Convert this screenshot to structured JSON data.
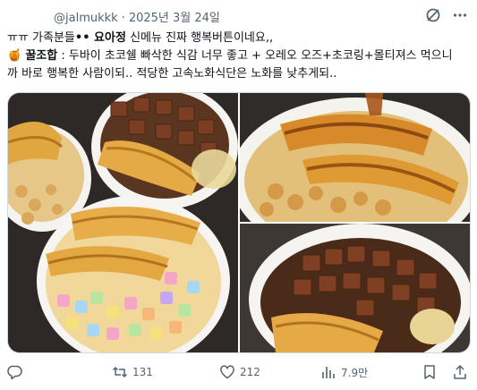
{
  "post": {
    "handle": "@jalmukkk",
    "separator": "·",
    "date": "2025년 3월 24일",
    "line1_prefix": "ㅠㅠ 가족분들",
    "line1_bold": "•• 요아정",
    "line1_suffix": " 신메뉴 진짜 행복버튼이네요,,",
    "line2_emoji": "🍯",
    "line2_bold": "꿀조합",
    "line2_rest": " : 두바이 초코쉘 빠삭한 식감 너무 좋고 + 오레오 오즈+초코링+몰티져스 먹으니",
    "line3": "까 바로 행복한 사람이되.. 적당한 고속노화식단은 노화를 낮추게되.."
  },
  "actions": {
    "replies": "",
    "retweets": "131",
    "likes": "212",
    "views": "7.9만"
  },
  "colors": {
    "text": "#0f1419",
    "muted": "#536471",
    "border": "#cfd9de"
  },
  "icons": [
    "grok-icon",
    "more-icon",
    "reply-icon",
    "retweet-icon",
    "like-icon",
    "views-icon",
    "bookmark-icon",
    "share-icon"
  ]
}
